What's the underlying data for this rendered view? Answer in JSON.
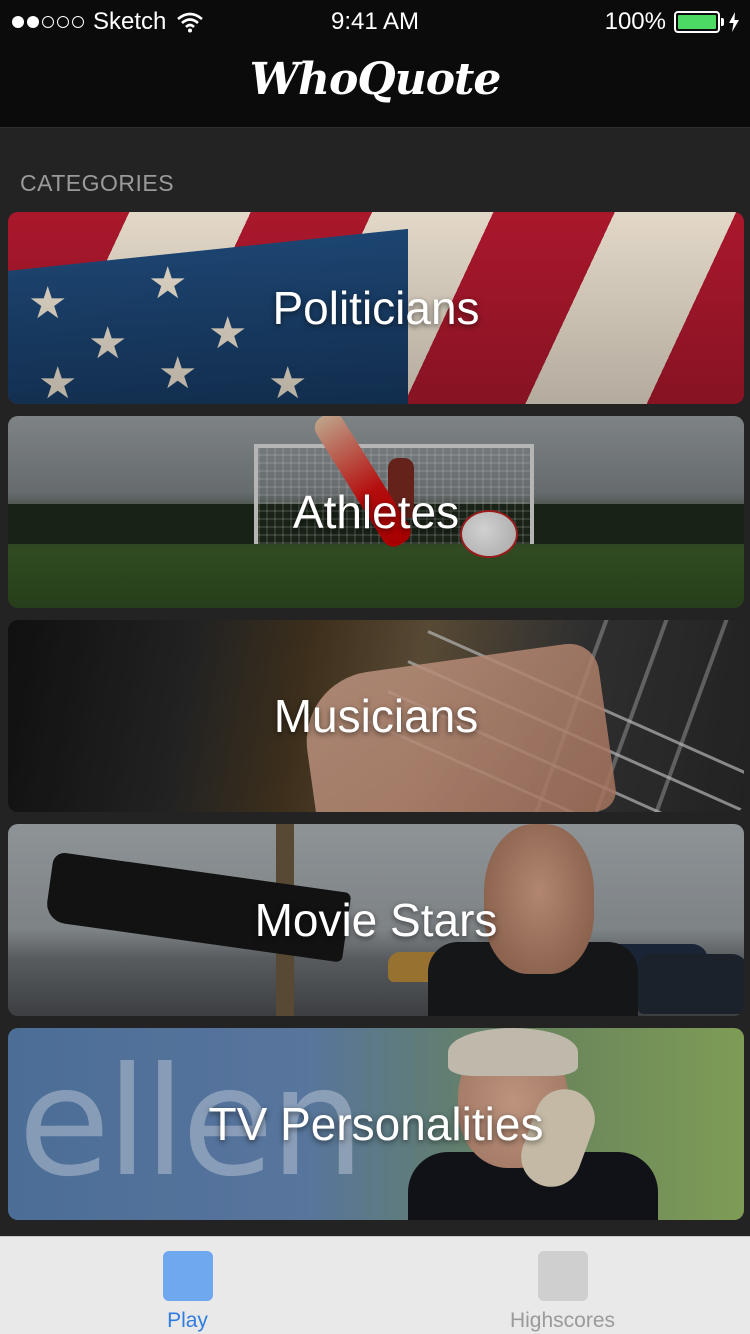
{
  "status_bar": {
    "carrier": "Sketch",
    "signal_bars_filled": 2,
    "signal_bars_total": 5,
    "time": "9:41 AM",
    "battery_percent": "100%",
    "battery_level": 1.0
  },
  "nav": {
    "title": "WhoQuote"
  },
  "section": {
    "header": "CATEGORIES"
  },
  "categories": [
    {
      "label": "Politicians"
    },
    {
      "label": "Athletes"
    },
    {
      "label": "Musicians"
    },
    {
      "label": "Movie Stars"
    },
    {
      "label": "TV Personalities"
    }
  ],
  "tv_card": {
    "background_text": "ellen"
  },
  "tab_bar": {
    "tabs": [
      {
        "label": "Play",
        "selected": true
      },
      {
        "label": "Highscores",
        "selected": false
      }
    ]
  },
  "colors": {
    "tab_selected": "#2f7de1",
    "tab_selected_icon": "#6fa8ef",
    "tab_unselected": "#9a9a9a",
    "battery_fill": "#4cd964",
    "background": "#232323"
  }
}
